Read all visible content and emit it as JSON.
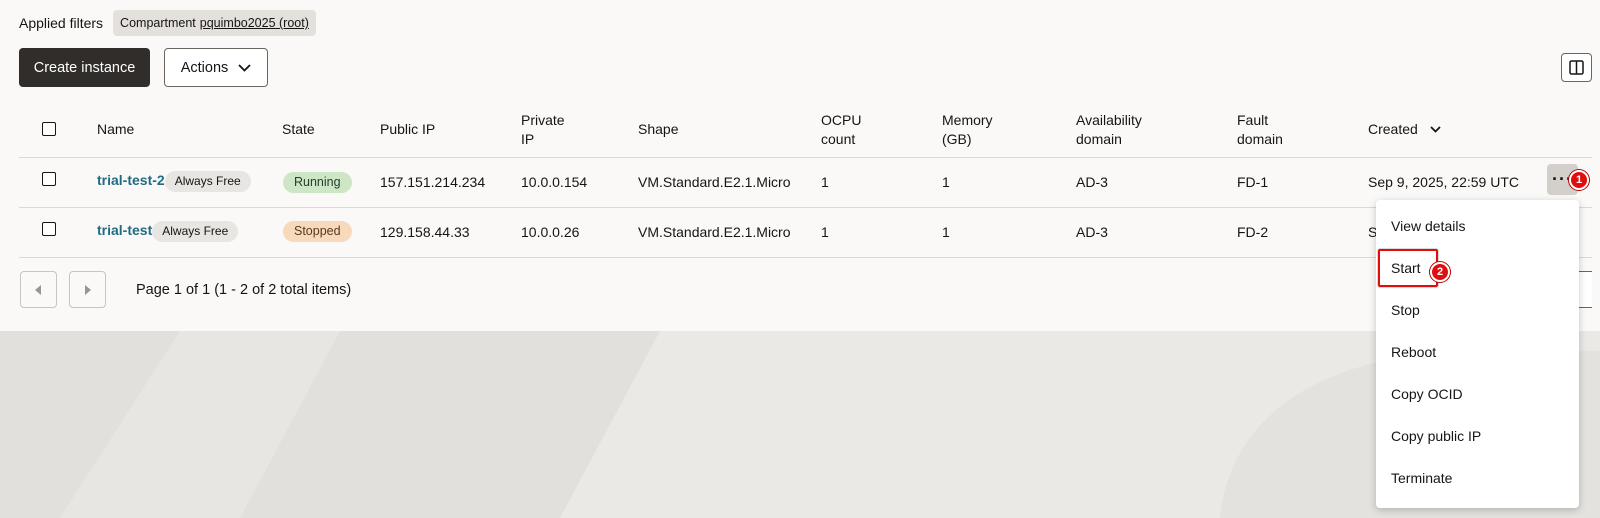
{
  "filters": {
    "label": "Applied filters",
    "chip_key": "Compartment",
    "chip_value": "pquimbo2025 (root)"
  },
  "toolbar": {
    "create_label": "Create instance",
    "actions_label": "Actions"
  },
  "table": {
    "headers": {
      "name": "Name",
      "state": "State",
      "public_ip": "Public IP",
      "private_ip_1": "Private",
      "private_ip_2": "IP",
      "shape": "Shape",
      "ocpu_1": "OCPU",
      "ocpu_2": "count",
      "memory_1": "Memory",
      "memory_2": "(GB)",
      "ad_1": "Availability",
      "ad_2": "domain",
      "fault_1": "Fault",
      "fault_2": "domain",
      "created": "Created"
    },
    "rows": [
      {
        "name": "trial-test-2",
        "tag": "Always Free",
        "state": "Running",
        "public_ip": "157.151.214.234",
        "private_ip": "10.0.0.154",
        "shape": "VM.Standard.E2.1.Micro",
        "ocpu": "1",
        "memory": "1",
        "ad": "AD-3",
        "fault": "FD-1",
        "created": "Sep 9, 2025, 22:59 UTC"
      },
      {
        "name": "trial-test",
        "tag": "Always Free",
        "state": "Stopped",
        "public_ip": "129.158.44.33",
        "private_ip": "10.0.0.26",
        "shape": "VM.Standard.E2.1.Micro",
        "ocpu": "1",
        "memory": "1",
        "ad": "AD-3",
        "fault": "FD-2",
        "created": "S"
      }
    ]
  },
  "pagination": {
    "text": "Page 1 of 1 (1 - 2 of 2 total items)"
  },
  "row_menu": {
    "button_label": "···",
    "items": [
      "View details",
      "Start",
      "Stop",
      "Reboot",
      "Copy OCID",
      "Copy public IP",
      "Terminate"
    ]
  },
  "annotations": {
    "step1": "1",
    "step2": "2",
    "color": "#e10d0d"
  }
}
